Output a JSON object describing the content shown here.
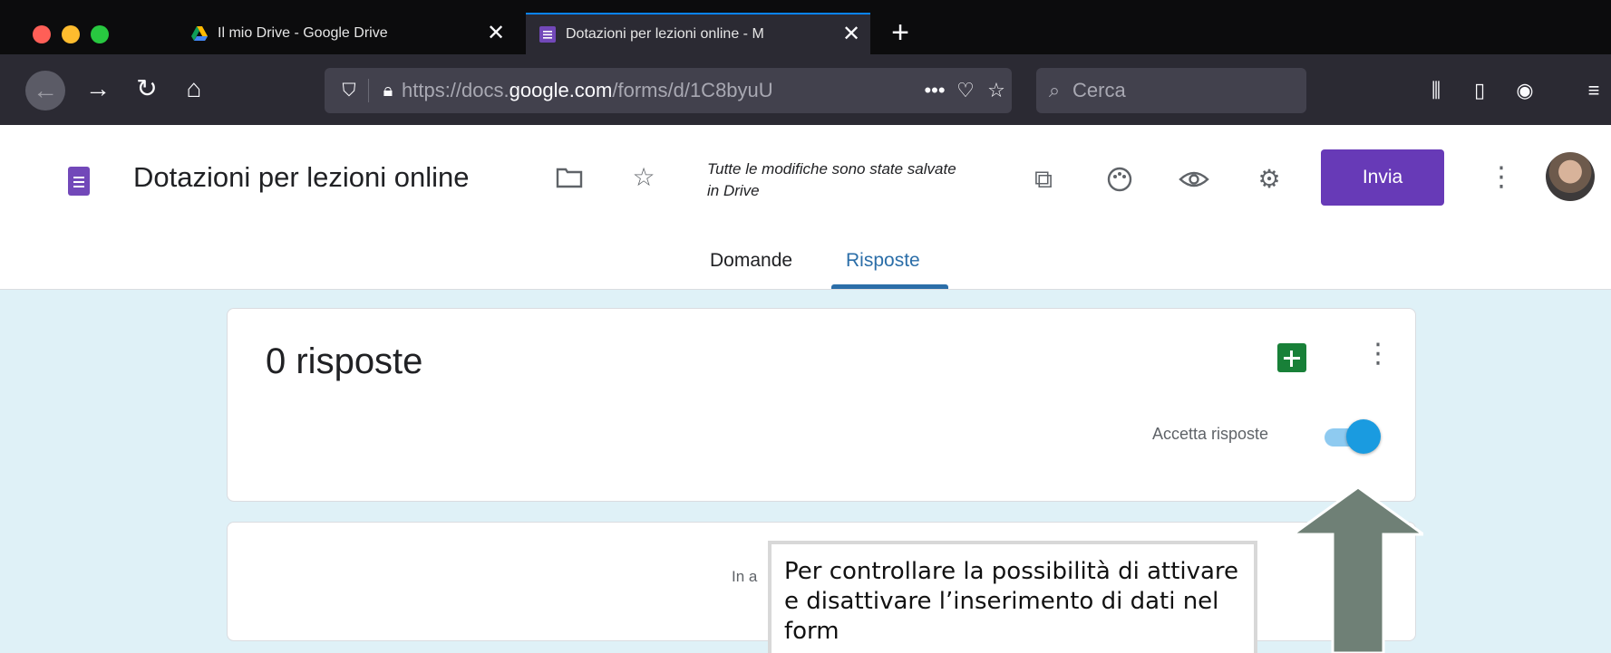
{
  "browser": {
    "tabs": [
      {
        "title": "Il mio Drive - Google Drive",
        "close": "✕",
        "favicon": "google-drive-icon"
      },
      {
        "title": "Dotazioni per lezioni online - M",
        "close": "✕",
        "favicon": "google-forms-icon"
      }
    ],
    "new_tab": "+",
    "url_prefix": "https://docs.",
    "url_domain": "google.com",
    "url_suffix": "/forms/d/1C8byuU",
    "url_more": "•••",
    "search_placeholder": "Cerca"
  },
  "forms": {
    "title": "Dotazioni per lezioni online",
    "save_status": "Tutte le modifiche sono state salvate in Drive",
    "send_label": "Invia",
    "tabs": [
      {
        "label": "Domande",
        "active": false
      },
      {
        "label": "Risposte",
        "active": true
      }
    ]
  },
  "responses": {
    "count_text": "0 risposte",
    "accept_label": "Accetta risposte",
    "accepting": true,
    "waiting_text": "In a"
  },
  "annotation": {
    "text": "Per controllare la possibilità di attivare e disattivare l’inserimento di dati nel form"
  },
  "colors": {
    "accent": "#673ab7",
    "toggle": "#1a9be0",
    "background": "#dff1f7",
    "arrow": "#6f8076"
  }
}
